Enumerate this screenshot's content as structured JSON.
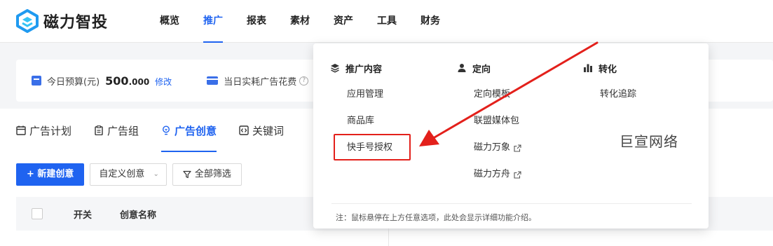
{
  "brand": {
    "name": "磁力智投",
    "color": "#1f63f0"
  },
  "nav": [
    {
      "label": "概览"
    },
    {
      "label": "推广"
    },
    {
      "label": "报表"
    },
    {
      "label": "素材"
    },
    {
      "label": "资产"
    },
    {
      "label": "工具"
    },
    {
      "label": "财务"
    }
  ],
  "budget": {
    "label": "今日预算(元)",
    "value": "500",
    "decimals": ".000",
    "edit": "修改",
    "spend_label": "当日实耗广告花费",
    "help": "?"
  },
  "tabs": [
    {
      "label": "广告计划",
      "icon": "calendar-icon"
    },
    {
      "label": "广告组",
      "icon": "clipboard-icon"
    },
    {
      "label": "广告创意",
      "icon": "bulb-icon"
    },
    {
      "label": "关键词",
      "icon": "code-icon"
    }
  ],
  "toolbar": {
    "create": "+ 新建创意",
    "custom": "自定义创意",
    "filter": "全部筛选"
  },
  "table": {
    "columns": [
      "开关",
      "创意名称"
    ]
  },
  "dropdown": {
    "columns": [
      {
        "title": "推广内容",
        "icon": "layers-icon",
        "items": [
          "应用管理",
          "商品库",
          "快手号授权"
        ]
      },
      {
        "title": "定向",
        "icon": "user-icon",
        "items": [
          "定向模板",
          "联盟媒体包",
          "磁力万象",
          "磁力方舟"
        ]
      },
      {
        "title": "转化",
        "icon": "bar-chart-icon",
        "items": [
          "转化追踪"
        ]
      }
    ],
    "note": "注：鼠标悬停在上方任意选项，此处会显示详细功能介绍。"
  },
  "watermark": "巨宣网络",
  "annotation_color": "#e3201b"
}
